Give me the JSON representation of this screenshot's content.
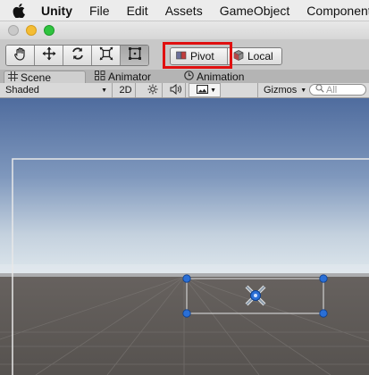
{
  "menubar": {
    "apple_icon": "apple-icon",
    "items": [
      "Unity",
      "File",
      "Edit",
      "Assets",
      "GameObject",
      "Component"
    ]
  },
  "toolbar": {
    "tools": [
      "hand-tool-icon",
      "move-tool-icon",
      "rotate-tool-icon",
      "scale-tool-icon",
      "rect-tool-icon"
    ],
    "pivot_label": "Pivot",
    "local_label": "Local",
    "highlight_color": "#e01010"
  },
  "tabs": {
    "scene": "Scene",
    "animator": "Animator",
    "animation": "Animation"
  },
  "scene_controls": {
    "shading_mode": "Shaded",
    "mode_2d": "2D",
    "gizmos": "Gizmos",
    "search_placeholder": "All"
  },
  "colors": {
    "sky_top": "#4f6c9e",
    "horizon": "#d8e2ea",
    "ground": "#5b5754",
    "selection_handle": "#2a6fd6"
  }
}
